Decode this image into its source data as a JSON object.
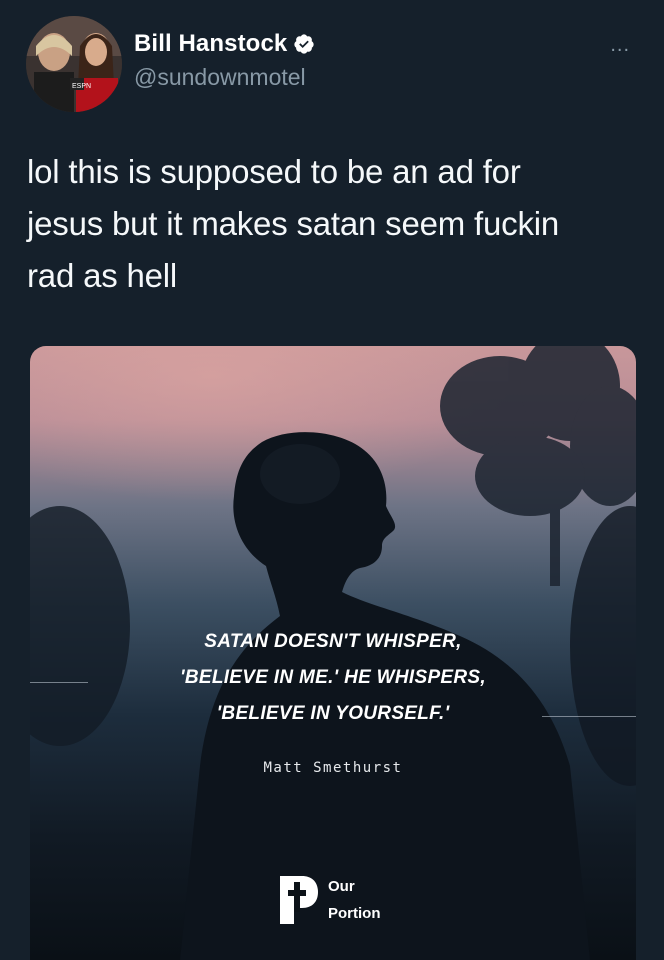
{
  "tweet": {
    "author": {
      "display_name": "Bill Hanstock",
      "handle": "@sundownmotel",
      "verified_icon": "verified-badge-icon",
      "avatar": "avatar"
    },
    "more_label": "...",
    "text_lines": [
      "lol this is supposed to be an ad for",
      "jesus but it makes satan seem fuckin",
      "rad as hell"
    ],
    "media": {
      "quote_lines": [
        "SATAN DOESN'T WHISPER,",
        "'BELIEVE IN ME.' HE WHISPERS,",
        "'BELIEVE IN YOURSELF.'"
      ],
      "attribution": "Matt Smethurst",
      "brand": {
        "logo_icon": "our-portion-logo-icon",
        "line1": "Our",
        "line2": "Portion"
      }
    }
  },
  "colors": {
    "background": "#15202b",
    "text": "#ffffff",
    "muted": "#8899a6",
    "verified": "#ffffff"
  }
}
